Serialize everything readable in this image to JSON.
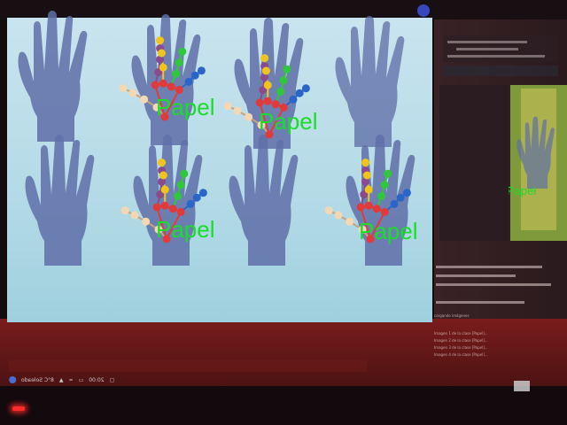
{
  "hands": {
    "labels": [
      "Papel",
      "Papel",
      "Papel",
      "Papel"
    ],
    "label_color": "#19dd28"
  },
  "side_window": {
    "inset_label": "Papel",
    "console_lines": [
      "cargando imágenes",
      "Imagen 1 de la clase [Papel]...",
      "Imagen 2 de la clase [Papel]...",
      "Imagen 3 de la clase [Papel]...",
      "Imagen 4 de la clase [Papel]..."
    ]
  },
  "taskbar": {
    "weather": "8°C Soleado",
    "time": "20:00"
  },
  "colors": {
    "screen_bg": "#b9dce6",
    "bezel": "#1a0f10",
    "thumb": "#e5433a",
    "index": "#f0c41a",
    "middle": "#2ec83a",
    "ring": "#2a66c9",
    "pinky": "#8a4a8c",
    "palm": "#e23a3a",
    "wrist_chain": "#f4d8b4"
  }
}
